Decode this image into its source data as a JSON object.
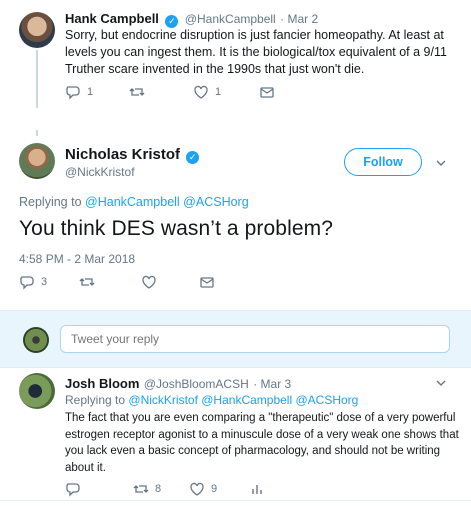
{
  "accent_color": "#1da1f2",
  "tweets": [
    {
      "name": "Hank Campbell",
      "handle": "@HankCampbell",
      "date": "· Mar 2",
      "verified": true,
      "text": "Sorry, but endocrine disruption is just fancier homeopathy. At least at levels you can ingest them. It is the biological/tox equivalent of a 9/11 Truther scare invented in the 1990s that just won't die.",
      "replies": "1",
      "retweets": "",
      "likes": "1",
      "icons": [
        "reply-icon",
        "retweet-icon",
        "like-icon",
        "message-icon"
      ]
    }
  ],
  "main_tweet": {
    "name": "Nicholas Kristof",
    "handle": "@NickKristof",
    "verified": true,
    "follow_label": "Follow",
    "replying_prefix": "Replying to",
    "replying_mentions": "@HankCampbell @ACSHorg",
    "text": "You think DES wasn’t a problem?",
    "timestamp": "4:58 PM - 2 Mar 2018",
    "replies": "3",
    "retweets": "",
    "likes": ""
  },
  "reply_box": {
    "placeholder": "Tweet your reply"
  },
  "reply_tweet": {
    "name": "Josh Bloom",
    "handle": "@JoshBloomACSH",
    "date": "· Mar 3",
    "replying_prefix": "Replying to",
    "replying_mentions": "@NickKristof @HankCampbell @ACSHorg",
    "text": "The fact that you are even comparing a \"therapeutic\" dose of a very powerful estrogen receptor agonist to a minuscule dose of a very weak one shows that you lack even a basic concept of pharmacology, and should not be writing about it.",
    "replies": "",
    "retweets": "8",
    "likes": "9",
    "icons": [
      "reply-icon",
      "retweet-icon",
      "like-icon",
      "analytics-icon"
    ]
  }
}
